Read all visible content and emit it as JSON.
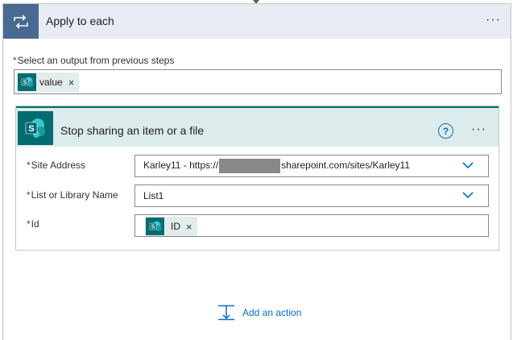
{
  "apply_to_each": {
    "title": "Apply to each",
    "more_icon": "ellipsis-icon",
    "loop_icon": "loop-icon",
    "select_output": {
      "required_mark": "*",
      "label": "Select an output from previous steps",
      "token": {
        "icon": "sharepoint-icon",
        "label": "value",
        "remove": "×"
      }
    }
  },
  "action": {
    "title": "Stop sharing an item or a file",
    "help_icon_text": "?",
    "icon": "sharepoint-icon",
    "fields": [
      {
        "required_mark": "*",
        "label": "Site Address",
        "value_prefix": "Karley11 - https://",
        "value_suffix": "sharepoint.com/sites/Karley11",
        "redacted": true
      },
      {
        "required_mark": "*",
        "label": "List or Library Name",
        "value": "List1"
      },
      {
        "required_mark": "*",
        "label": "Id",
        "token": {
          "icon": "sharepoint-icon",
          "label": "ID",
          "remove": "×"
        }
      }
    ]
  },
  "add_action": {
    "label": "Add an action",
    "icon": "add-action-icon"
  },
  "colors": {
    "loop_header_bg": "#e8ebf3",
    "loop_icon_bg": "#486991",
    "sharepoint_teal": "#036c70",
    "action_header_bg": "#dcebeb",
    "link_blue": "#0f6cbd",
    "required_red": "#a4262c"
  }
}
